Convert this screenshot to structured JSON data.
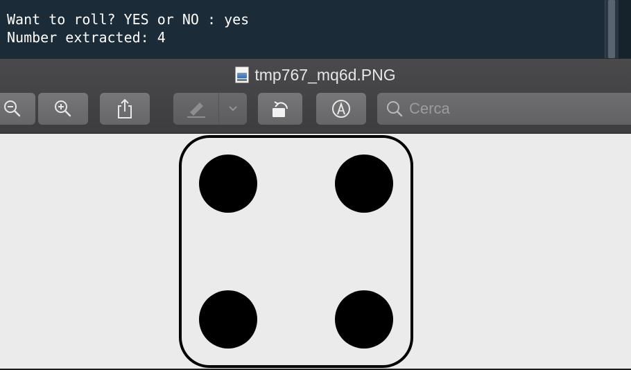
{
  "terminal": {
    "line1": "Want to roll? YES or NO : yes",
    "line2": "Number extracted: 4"
  },
  "window": {
    "title": "tmp767_mq6d.PNG",
    "file_icon": "image-file-icon"
  },
  "toolbar": {
    "buttons": [
      {
        "name": "zoom-out",
        "icon": "zoom-out-icon"
      },
      {
        "name": "zoom-in",
        "icon": "zoom-in-icon"
      },
      {
        "name": "share",
        "icon": "share-icon"
      },
      {
        "name": "highlight",
        "icon": "highlighter-icon"
      },
      {
        "name": "highlight-menu",
        "icon": "chevron-down-icon"
      },
      {
        "name": "rotate",
        "icon": "rotate-left-icon"
      },
      {
        "name": "markup",
        "icon": "markup-pen-icon"
      }
    ],
    "search": {
      "placeholder": "Cerca",
      "icon": "search-icon"
    }
  },
  "document": {
    "die_face_value": 4
  },
  "colors": {
    "terminal_bg": "#1c2b38",
    "toolbar_bg": "#444446",
    "canvas_bg": "#ebebeb",
    "pip": "#000000"
  }
}
